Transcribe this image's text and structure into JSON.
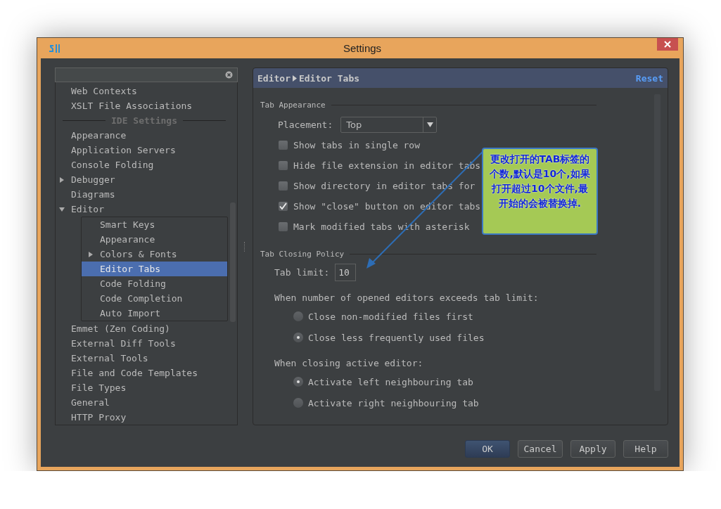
{
  "window": {
    "title": "Settings"
  },
  "tree": [
    {
      "kind": "item",
      "label": "Web Contexts",
      "selected": false
    },
    {
      "kind": "item",
      "label": "XSLT File Associations",
      "selected": false
    },
    {
      "kind": "header",
      "label": "IDE Settings"
    },
    {
      "kind": "item",
      "label": "Appearance",
      "selected": false
    },
    {
      "kind": "item",
      "label": "Application Servers",
      "selected": false
    },
    {
      "kind": "item",
      "label": "Console Folding",
      "selected": false
    },
    {
      "kind": "item",
      "label": "Debugger",
      "selected": false,
      "expanded": false
    },
    {
      "kind": "item",
      "label": "Diagrams",
      "selected": false
    },
    {
      "kind": "item",
      "label": "Editor",
      "selected": false,
      "expanded": true,
      "children": [
        {
          "kind": "item",
          "label": "Smart Keys",
          "selected": false
        },
        {
          "kind": "item",
          "label": "Appearance",
          "selected": false
        },
        {
          "kind": "item",
          "label": "Colors & Fonts",
          "selected": false,
          "expanded": false
        },
        {
          "kind": "item",
          "label": "Editor Tabs",
          "selected": true
        },
        {
          "kind": "item",
          "label": "Code Folding",
          "selected": false
        },
        {
          "kind": "item",
          "label": "Code Completion",
          "selected": false
        },
        {
          "kind": "item",
          "label": "Auto Import",
          "selected": false
        }
      ]
    },
    {
      "kind": "item",
      "label": "Emmet (Zen Coding)",
      "selected": false
    },
    {
      "kind": "item",
      "label": "External Diff Tools",
      "selected": false
    },
    {
      "kind": "item",
      "label": "External Tools",
      "selected": false
    },
    {
      "kind": "item",
      "label": "File and Code Templates",
      "selected": false
    },
    {
      "kind": "item",
      "label": "File Types",
      "selected": false
    },
    {
      "kind": "item",
      "label": "General",
      "selected": false
    },
    {
      "kind": "item",
      "label": "HTTP Proxy",
      "selected": false
    }
  ],
  "panel": {
    "breadcrumb": [
      "Editor",
      "Editor Tabs"
    ],
    "reset": "Reset",
    "sections": [
      {
        "title": "Tab Appearance",
        "rows": [
          {
            "kind": "dropdown",
            "label": "Placement:",
            "value": "Top"
          },
          {
            "kind": "checkbox",
            "label": "Show tabs in single row",
            "checked": false
          },
          {
            "kind": "checkbox",
            "label": "Hide file extension in editor tabs",
            "checked": false
          },
          {
            "kind": "checkbox",
            "label": "Show directory in editor tabs for",
            "checked": false
          },
          {
            "kind": "checkbox",
            "label": "Show \"close\" button on editor tabs",
            "checked": true
          },
          {
            "kind": "checkbox",
            "label": "Mark modified tabs with asterisk",
            "checked": false
          }
        ]
      },
      {
        "title": "Tab Closing Policy",
        "rows": [
          {
            "kind": "field",
            "label": "Tab limit:",
            "value": "10"
          },
          {
            "kind": "text",
            "label": "When number of opened editors exceeds tab limit:"
          },
          {
            "kind": "radio",
            "label": "Close non-modified files first",
            "selected": false
          },
          {
            "kind": "radio",
            "label": "Close less frequently used files",
            "selected": true
          },
          {
            "kind": "text",
            "label": "When closing active editor:"
          },
          {
            "kind": "radio",
            "label": "Activate left neighbouring tab",
            "selected": true
          },
          {
            "kind": "radio",
            "label": "Activate right neighbouring tab",
            "selected": false
          }
        ]
      }
    ]
  },
  "callout": {
    "text": "更改打开的TAB标签的个数,默认是10个,如果打开超过10个文件,最开始的会被替换掉."
  },
  "buttons": [
    {
      "label": "OK",
      "default": true
    },
    {
      "label": "Cancel",
      "default": false
    },
    {
      "label": "Apply",
      "default": false
    },
    {
      "label": "Help",
      "default": false
    }
  ]
}
